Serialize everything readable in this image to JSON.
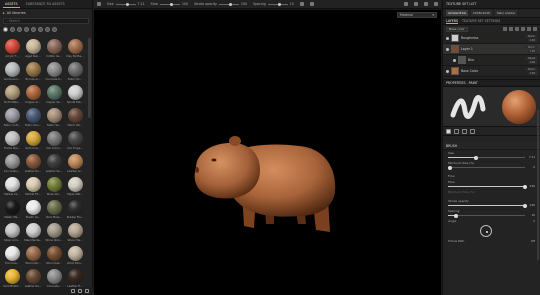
{
  "left_panel": {
    "tabs": [
      "ASSETS",
      "SUBSTANCE 3D ASSETS"
    ],
    "breadcrumb": "All libraries",
    "search_placeholder": "Search",
    "materials": [
      {
        "label": "Acrylic T...",
        "color": "#d44a3a"
      },
      {
        "label": "Aged Pain...",
        "color": "#c9b79a"
      },
      {
        "label": "Cotton Ca...",
        "color": "#8a6a5a"
      },
      {
        "label": "Clay Earthe...",
        "color": "#a5704e"
      },
      {
        "label": "Aluminium...",
        "color": "#b9bcbe"
      },
      {
        "label": "Bronze Ar...",
        "color": "#9c7a4a"
      },
      {
        "label": "Concrete S...",
        "color": "#8d8d8d"
      },
      {
        "label": "Fabric Ro...",
        "color": "#6f6f6f"
      },
      {
        "label": "Cloth Mate...",
        "color": "#b4a07c"
      },
      {
        "label": "Copper Ar...",
        "color": "#b06a3c"
      },
      {
        "label": "Copper Ve...",
        "color": "#5c7a6a"
      },
      {
        "label": "Sports Fab...",
        "color": "#d0d0d0"
      },
      {
        "label": "Fabric Cott...",
        "color": "#9b9ba4"
      },
      {
        "label": "Fabric Den...",
        "color": "#4c5b7a"
      },
      {
        "label": "Fabric Sa...",
        "color": "#a68f7a"
      },
      {
        "label": "Fabric Wo...",
        "color": "#6a4a3a"
      },
      {
        "label": "Frame Sha...",
        "color": "#c2c2c2"
      },
      {
        "label": "Gold Arno...",
        "color": "#d6a93a"
      },
      {
        "label": "Iron Armor...",
        "color": "#7a7a7c"
      },
      {
        "label": "Iron Forge...",
        "color": "#4a4a4a"
      },
      {
        "label": "Iron Gratin...",
        "color": "#9a9a9a"
      },
      {
        "label": "Leather Ro...",
        "color": "#8d5a3c"
      },
      {
        "label": "Leather Se...",
        "color": "#3f3f3f"
      },
      {
        "label": "Leather Ar...",
        "color": "#bf8a5a"
      },
      {
        "label": "Marble Ca...",
        "color": "#e2e2e2"
      },
      {
        "label": "Marble Tit...",
        "color": "#d9cbb2"
      },
      {
        "label": "Moss Stu...",
        "color": "#76813a"
      },
      {
        "label": "Paper Mat...",
        "color": "#d4cfc3"
      },
      {
        "label": "Plastic Ma...",
        "color": "#1a1a1a"
      },
      {
        "label": "Plastic Gl...",
        "color": "#ebebeb"
      },
      {
        "label": "Rock Moss...",
        "color": "#6b6e4c"
      },
      {
        "label": "Rubber Fla...",
        "color": "#2e2e2e"
      },
      {
        "label": "Silver Arm...",
        "color": "#c6c6c8"
      },
      {
        "label": "Steel Painte...",
        "color": "#d0d0d0"
      },
      {
        "label": "Stone Rock...",
        "color": "#a39b8d"
      },
      {
        "label": "Stone Tile...",
        "color": "#b7a793"
      },
      {
        "label": "Tile Cera...",
        "color": "#e8e8e8"
      },
      {
        "label": "Wood Ash...",
        "color": "#9c6b4a"
      },
      {
        "label": "Wood Oak...",
        "color": "#7c5233"
      },
      {
        "label": "Wood Pain...",
        "color": "#c4b6a2"
      },
      {
        "label": "Gold Bright...",
        "color": "#e8b534"
      },
      {
        "label": "Leather Ru...",
        "color": "#6a4a35"
      },
      {
        "label": "Concrete...",
        "color": "#8c8c8c"
      },
      {
        "label": "Leather Fi...",
        "color": "#3a2a22"
      }
    ]
  },
  "toolbar": {
    "size_label": "Size",
    "size_value": "7.11",
    "flow_label": "Flow",
    "flow_value": "100",
    "stroke_label": "Stroke opacity",
    "stroke_value": "100",
    "spacing_label": "Spacing",
    "spacing_value": "10"
  },
  "viewport": {
    "mode_label": "Material"
  },
  "right_panel": {
    "texture_set_title": "TEXTURE SET LIST",
    "texture_set_name": "lambert1SG",
    "texture_set_res": "2048x2048",
    "texture_set_shader": "Main shader",
    "tabs": [
      "LAYERS",
      "TEXTURE SET SETTINGS"
    ],
    "base_color_select": "Base color",
    "layers": [
      {
        "name": "Roughness",
        "blend": "Norm",
        "opacity": "100",
        "thumb": "#cfcfcf"
      },
      {
        "name": "Layer 1",
        "blend": "Norm",
        "opacity": "100",
        "thumb": "#7a4a2c"
      },
      {
        "name": "Blur",
        "blend": "Passt",
        "opacity": "100",
        "thumb": "#555555"
      },
      {
        "name": "Base Color",
        "blend": "Norm",
        "opacity": "100",
        "thumb": "#b06d40"
      }
    ],
    "properties_title": "PROPERTIES - PAINT",
    "brush_section": "BRUSH",
    "size_label": "Size",
    "size_value": "7.11",
    "size_fraction": 0.36,
    "min_size_label": "Minimum Size (%)",
    "min_size_value": "0",
    "min_size_fraction": 0.02,
    "flow_section": "Flow",
    "flow_label": "Flow",
    "flow_value": "100",
    "flow_fraction": 1.0,
    "min_flow_label": "Minimum Flow (%)",
    "stroke_opacity_label": "Stroke opacity",
    "stroke_opacity_value": "100",
    "stroke_opacity_fraction": 1.0,
    "spacing_label": "Spacing",
    "spacing_value": "10",
    "spacing_fraction": 0.1,
    "angle_label": "Angle",
    "angle_value": "0",
    "follow_path_label": "Follow Path",
    "follow_path_value": "Off",
    "accent_color": "#e2a13a",
    "preview_color": "#b5663a"
  },
  "model": {
    "body_color": "#a8643a"
  }
}
